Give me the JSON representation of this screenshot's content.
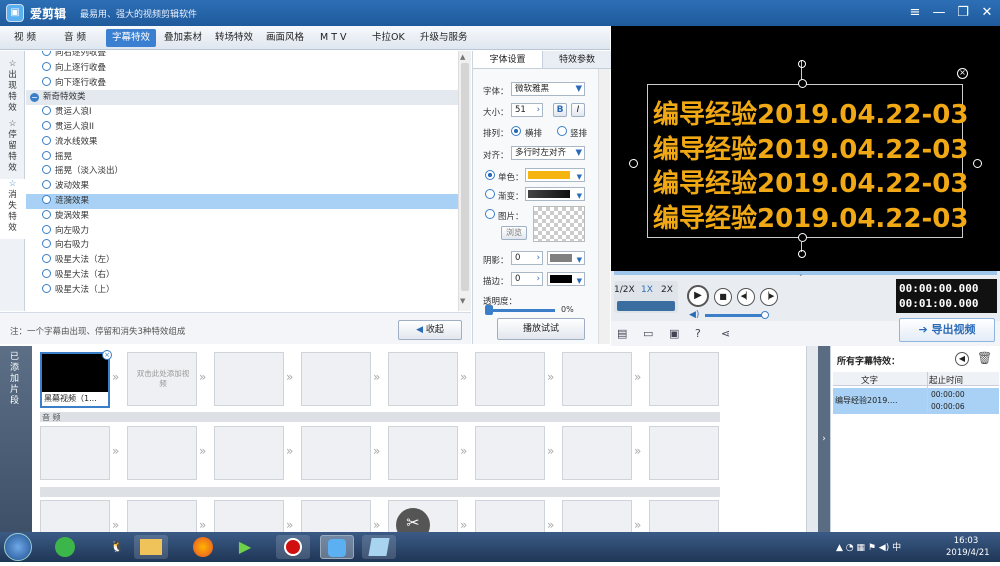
{
  "app": {
    "name": "爱剪辑",
    "slogan": "最易用、强大的视频剪辑软件"
  },
  "window_controls": [
    "≡",
    "—",
    "❐",
    "✕"
  ],
  "menu": [
    "视  频",
    "音  频",
    "字幕特效",
    "叠加素材",
    "转场特效",
    "画面风格",
    "M T V",
    "卡拉OK",
    "升级与服务"
  ],
  "menu_active": 2,
  "side_tabs": [
    {
      "label": "出现特效",
      "icon": "☆"
    },
    {
      "label": "停留特效",
      "icon": "☆"
    },
    {
      "label": "消失特效",
      "icon": "☆"
    }
  ],
  "effects": [
    {
      "label": "向右逐列收叠",
      "type": "item"
    },
    {
      "label": "向上逐行收叠",
      "type": "item"
    },
    {
      "label": "向下逐行收叠",
      "type": "item"
    },
    {
      "label": "新奇特效类",
      "type": "cat"
    },
    {
      "label": "贯运人浪I",
      "type": "item"
    },
    {
      "label": "贯运人浪II",
      "type": "item"
    },
    {
      "label": "流水线效果",
      "type": "item"
    },
    {
      "label": "摇晃",
      "type": "item"
    },
    {
      "label": "摇晃（淡入淡出）",
      "type": "item"
    },
    {
      "label": "波动效果",
      "type": "item"
    },
    {
      "label": "涟漪效果",
      "type": "sel"
    },
    {
      "label": "旋涡效果",
      "type": "item"
    },
    {
      "label": "向左吸力",
      "type": "item"
    },
    {
      "label": "向右吸力",
      "type": "item"
    },
    {
      "label": "吸星大法（左）",
      "type": "item"
    },
    {
      "label": "吸星大法（右）",
      "type": "item"
    },
    {
      "label": "吸星大法（上）",
      "type": "item"
    }
  ],
  "note": "注：一个字幕由出现、停留和消失3种特效组成",
  "collapse_btn": "收起",
  "play_test_btn": "播放试试",
  "props": {
    "tab1": "字体设置",
    "tab2": "特效参数",
    "font_label": "字体：",
    "font_value": "微软雅黑",
    "size_label": "大小：",
    "size_value": "51",
    "bold": "B",
    "italic": "I",
    "arrange_label": "排列：",
    "horizontal": "横排",
    "vertical": "竖排",
    "align_label": "对齐：",
    "align_value": "多行时左对齐",
    "solid": "单色：",
    "gradient": "渐变：",
    "image": "图片：",
    "browse": "浏览",
    "shadow_label": "阴影：",
    "shadow_value": "0",
    "stroke_label": "描边：",
    "stroke_value": "0",
    "opacity_label": "透明度：",
    "opacity_value": "0%"
  },
  "colors": {
    "solid": "#f5b40f",
    "gradient": "#111111",
    "shadow": "#808080",
    "stroke": "#000000",
    "subtitle": "#f0a814"
  },
  "subtitle_lines": [
    "编导经验2019.04.22-03",
    "编导经验2019.04.22-03",
    "编导经验2019.04.22-03",
    "编导经验2019.04.22-03"
  ],
  "player": {
    "speeds": [
      "1/2X",
      "1X",
      "2X"
    ],
    "time_current": "00:00:00.000",
    "time_total": "00:01:00.000",
    "export": "导出视频"
  },
  "timeline": {
    "side_label": "已添加片段",
    "clip1": "黑幕视频（1...",
    "add_hint": "双击此处添加视频",
    "audio_label": "音 频"
  },
  "effects_panel": {
    "title": "所有字幕特效：",
    "col_text": "文字",
    "col_time": "起止时间",
    "row_text": "编导经验2019....",
    "row_start": "00:00:00",
    "row_end": "00:00:06"
  },
  "taskbar": {
    "time": "16:03",
    "date": "2019/4/21"
  }
}
